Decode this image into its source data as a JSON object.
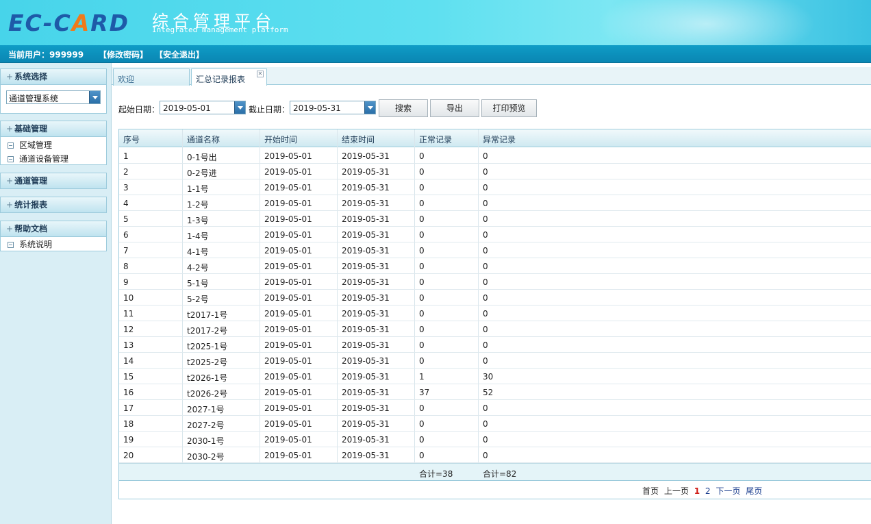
{
  "header": {
    "logo_prefix": "EC-C",
    "logo_accent": "A",
    "logo_suffix": "RD",
    "title_cn": "综合管理平台",
    "title_en": "Integrated management platform"
  },
  "userbar": {
    "current_user": "当前用户：999999",
    "change_password": "【修改密码】",
    "logout": "【安全退出】"
  },
  "sidebar": {
    "system_section": {
      "title": "系统选择",
      "selected": "通道管理系统"
    },
    "sections": [
      {
        "title": "基础管理",
        "items": [
          "区域管理",
          "通道设备管理"
        ]
      },
      {
        "title": "通道管理",
        "items": []
      },
      {
        "title": "统计报表",
        "items": []
      },
      {
        "title": "帮助文档",
        "items": [
          "系统说明"
        ]
      }
    ]
  },
  "tabs": [
    {
      "label": "欢迎",
      "active": false
    },
    {
      "label": "汇总记录报表",
      "active": true
    }
  ],
  "filters": {
    "start_label": "起始日期：",
    "start_value": "2019-05-01",
    "end_label": "截止日期：",
    "end_value": "2019-05-31",
    "search_button": "搜索",
    "export_button": "导出",
    "print_button": "打印预览"
  },
  "table": {
    "columns": [
      "序号",
      "通道名称",
      "开始时间",
      "结束时间",
      "正常记录",
      "异常记录"
    ],
    "rows": [
      [
        "1",
        "0-1号出",
        "2019-05-01",
        "2019-05-31",
        "0",
        "0"
      ],
      [
        "2",
        "0-2号进",
        "2019-05-01",
        "2019-05-31",
        "0",
        "0"
      ],
      [
        "3",
        "1-1号",
        "2019-05-01",
        "2019-05-31",
        "0",
        "0"
      ],
      [
        "4",
        "1-2号",
        "2019-05-01",
        "2019-05-31",
        "0",
        "0"
      ],
      [
        "5",
        "1-3号",
        "2019-05-01",
        "2019-05-31",
        "0",
        "0"
      ],
      [
        "6",
        "1-4号",
        "2019-05-01",
        "2019-05-31",
        "0",
        "0"
      ],
      [
        "7",
        "4-1号",
        "2019-05-01",
        "2019-05-31",
        "0",
        "0"
      ],
      [
        "8",
        "4-2号",
        "2019-05-01",
        "2019-05-31",
        "0",
        "0"
      ],
      [
        "9",
        "5-1号",
        "2019-05-01",
        "2019-05-31",
        "0",
        "0"
      ],
      [
        "10",
        "5-2号",
        "2019-05-01",
        "2019-05-31",
        "0",
        "0"
      ],
      [
        "11",
        "t2017-1号",
        "2019-05-01",
        "2019-05-31",
        "0",
        "0"
      ],
      [
        "12",
        "t2017-2号",
        "2019-05-01",
        "2019-05-31",
        "0",
        "0"
      ],
      [
        "13",
        "t2025-1号",
        "2019-05-01",
        "2019-05-31",
        "0",
        "0"
      ],
      [
        "14",
        "t2025-2号",
        "2019-05-01",
        "2019-05-31",
        "0",
        "0"
      ],
      [
        "15",
        "t2026-1号",
        "2019-05-01",
        "2019-05-31",
        "1",
        "30"
      ],
      [
        "16",
        "t2026-2号",
        "2019-05-01",
        "2019-05-31",
        "37",
        "52"
      ],
      [
        "17",
        "2027-1号",
        "2019-05-01",
        "2019-05-31",
        "0",
        "0"
      ],
      [
        "18",
        "2027-2号",
        "2019-05-01",
        "2019-05-31",
        "0",
        "0"
      ],
      [
        "19",
        "2030-1号",
        "2019-05-01",
        "2019-05-31",
        "0",
        "0"
      ],
      [
        "20",
        "2030-2号",
        "2019-05-01",
        "2019-05-31",
        "0",
        "0"
      ]
    ],
    "total_normal": "合计=38",
    "total_abnormal": "合计=82"
  },
  "pager": {
    "first": "首页",
    "prev": "上一页",
    "pages": [
      "1",
      "2"
    ],
    "current": "1",
    "next": "下一页",
    "last": "尾页"
  },
  "colors": {
    "header_cyan": "#5fe0f0",
    "userbar_blue": "#0f9cc6",
    "logo_blue": "#1e5aa8",
    "logo_orange": "#f07a1a",
    "sidebar_bg": "#d9eef5",
    "pager_current": "#d0201a"
  }
}
